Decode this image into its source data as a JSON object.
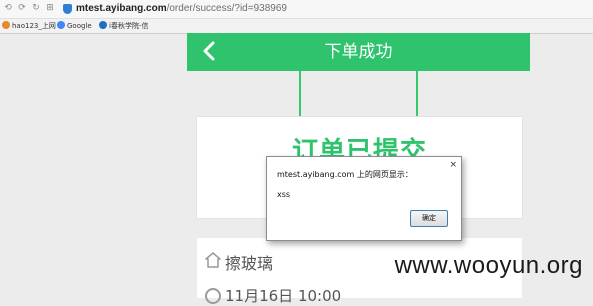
{
  "browser": {
    "url_domain": "mtest.ayibang.com",
    "url_path": "/order/success/?id=938969",
    "bookmarks": [
      {
        "label": "hao123_上网",
        "icon": "hao123-icon",
        "color": "#e6892a"
      },
      {
        "label": "Google",
        "icon": "google-icon",
        "color": "#4285f4"
      },
      {
        "label": "i春秋学院-信",
        "icon": "ichunqiu-icon",
        "color": "#1e6fc2"
      }
    ]
  },
  "page": {
    "header_title": "下单成功",
    "success_text": "订单已提交",
    "service_name": "擦玻璃",
    "service_time": "11月16日 10:00",
    "accent_color": "#2ec36c"
  },
  "dialog": {
    "title": "mtest.ayibang.com 上的网页显示：",
    "message": "xss",
    "ok_label": "确定",
    "close_glyph": "×"
  },
  "watermark": "www.wooyun.org"
}
